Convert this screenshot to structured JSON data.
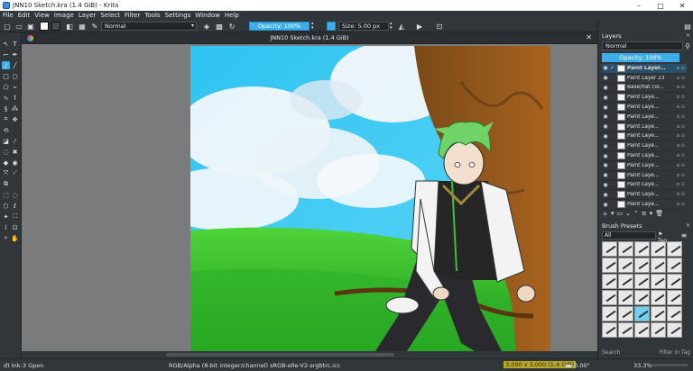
{
  "window": {
    "title": "JNN10 Sketch.kra (1.4 GiB) - Krita",
    "minimize": "–",
    "maximize": "□",
    "close": "✕"
  },
  "menu": [
    "File",
    "Edit",
    "View",
    "Image",
    "Layer",
    "Select",
    "Filter",
    "Tools",
    "Settings",
    "Window",
    "Help"
  ],
  "toolbar": {
    "blend_mode": "Normal",
    "opacity": "Opacity: 100%",
    "size": "Size: 5.00 px",
    "foreground_color": "#4a4a4a",
    "background_color": "#ffffff"
  },
  "document": {
    "tab_title": "JNN10 Sketch.kra (1.4 GiB)",
    "close": "✕"
  },
  "dock": {
    "layers_title": "Layers",
    "blend_mode": "Normal",
    "opacity": "Opacity: 100%",
    "layers": [
      {
        "name": "Paint Layer...",
        "selected": true
      },
      {
        "name": "Paint Layer 23",
        "selected": false
      },
      {
        "name": "Base/flat col...",
        "selected": false
      },
      {
        "name": "Paint Laye...",
        "selected": false
      },
      {
        "name": "Paint Laye...",
        "selected": false
      },
      {
        "name": "Paint Laye...",
        "selected": false
      },
      {
        "name": "Paint Laye...",
        "selected": false
      },
      {
        "name": "Paint Laye...",
        "selected": false
      },
      {
        "name": "Paint Laye...",
        "selected": false
      },
      {
        "name": "Paint Laye...",
        "selected": false
      },
      {
        "name": "Paint Laye...",
        "selected": false
      },
      {
        "name": "Paint Laye...",
        "selected": false
      },
      {
        "name": "Paint Laye...",
        "selected": false
      },
      {
        "name": "Paint Laye...",
        "selected": false
      },
      {
        "name": "Paint Laye...",
        "selected": false
      }
    ],
    "brush_presets_title": "Brush Presets",
    "brush_filter": "All",
    "tag_label": "Tag",
    "search_placeholder": "Search",
    "filter_in_tag": "Filter in Tag"
  },
  "statusbar": {
    "brush": "d) Ink-3 Gpen",
    "color_space": "RGB/Alpha (8-bit integer/channel)  sRGB-elle-V2-srgbtrc.icc",
    "canvas_size": "3,000 x 3,000 (1.4 GiB)",
    "rotation": "0.00°",
    "zoom": "33.3%"
  }
}
